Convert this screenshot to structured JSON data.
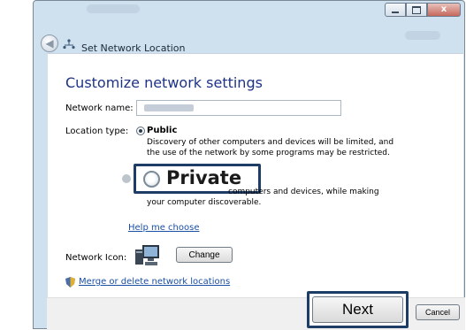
{
  "window": {
    "title": "Set Network Location",
    "controls": {
      "minimize": "minimize",
      "maximize": "maximize",
      "close": "x"
    }
  },
  "main": {
    "heading": "Customize network settings",
    "network_name": {
      "label": "Network name:",
      "value": ""
    },
    "location_type": {
      "label": "Location type:",
      "options": [
        {
          "label": "Public",
          "selected": true,
          "description_line1": "Discovery of other computers and devices will be limited, and",
          "description_line2": "the use of the network by some programs may be restricted."
        },
        {
          "label": "Private",
          "selected": false,
          "description_line1": "computers and devices, while making",
          "description_line2": "your computer discoverable."
        }
      ]
    },
    "help_link": "Help me choose",
    "network_icon": {
      "label": "Network Icon:",
      "button": "Change"
    },
    "merge_link": "Merge or delete network locations"
  },
  "footer": {
    "next": "Next",
    "cancel": "Cancel"
  },
  "icons": {
    "back": "back-arrow-icon",
    "network": "network-icon",
    "monitor": "network-monitor-icon",
    "shield": "uac-shield-icon"
  },
  "colors": {
    "heading": "#1e3287",
    "link": "#1a4fa3",
    "highlight_border": "#1e3d66"
  }
}
